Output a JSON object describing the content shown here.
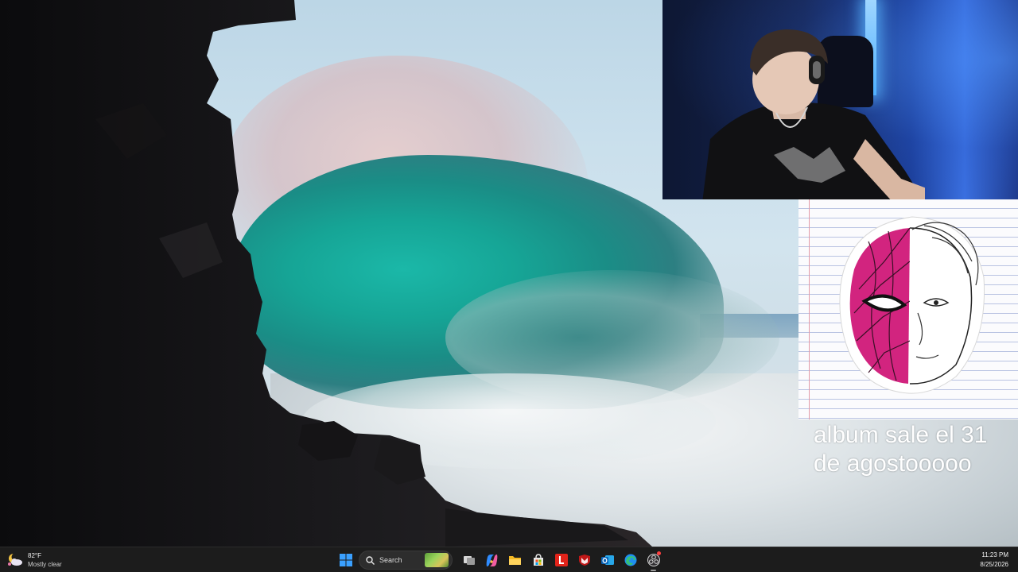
{
  "desktop": {
    "wallpaper_subject": "ocean-wave-crashing-on-cliff"
  },
  "stream_overlay": {
    "webcam_label": "webcam-feed",
    "album_cover_label": "album-cover-art",
    "caption": "album sale el 31\nde agostooooo"
  },
  "taskbar": {
    "weather": {
      "temperature": "82°F",
      "condition": "Mostly clear",
      "icon": "weather-moon-cloud-icon"
    },
    "search": {
      "label": "Search",
      "icon": "search-icon"
    },
    "pinned_apps": [
      {
        "name": "start",
        "icon": "windows-start-icon"
      },
      {
        "name": "task-view",
        "icon": "task-view-icon"
      },
      {
        "name": "copilot",
        "icon": "copilot-icon"
      },
      {
        "name": "file-explorer",
        "icon": "folder-icon"
      },
      {
        "name": "microsoft-store",
        "icon": "store-icon"
      },
      {
        "name": "lenovo",
        "icon": "lenovo-l-icon"
      },
      {
        "name": "mcafee",
        "icon": "mcafee-shield-icon"
      },
      {
        "name": "outlook",
        "icon": "outlook-icon"
      },
      {
        "name": "edge",
        "icon": "edge-icon"
      },
      {
        "name": "obs",
        "icon": "obs-icon"
      }
    ],
    "clock": {
      "time": "11:23 PM",
      "date": "8/25/2026"
    },
    "colors": {
      "background": "#1c1c1c",
      "windows_blue": "#3aa0ff",
      "lenovo_red": "#e2231a",
      "mcafee_red": "#c01818"
    }
  }
}
